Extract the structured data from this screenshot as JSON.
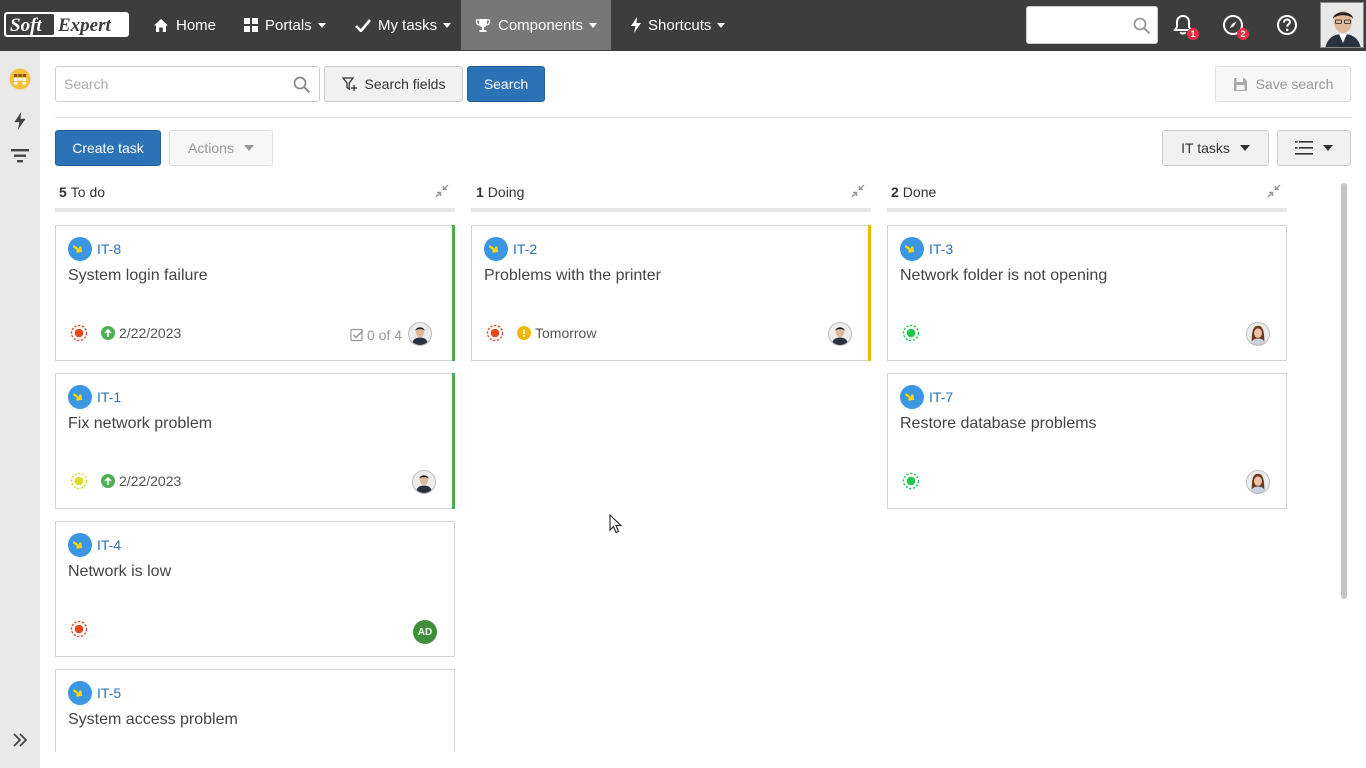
{
  "logo": {
    "part1": "Soft",
    "part2": "Expert"
  },
  "nav": {
    "home": "Home",
    "portals": "Portals",
    "my_tasks": "My tasks",
    "components": "Components",
    "shortcuts": "Shortcuts"
  },
  "top": {
    "search_placeholder": "",
    "notifications_count": "1",
    "activities_count": "2"
  },
  "toolbar": {
    "search_placeholder": "Search",
    "search_fields_label": "Search fields",
    "search_label": "Search",
    "save_search_label": "Save search",
    "create_task_label": "Create task",
    "actions_label": "Actions",
    "view_label": "IT tasks"
  },
  "columns": [
    {
      "count": "5",
      "name": "To do"
    },
    {
      "count": "1",
      "name": "Doing"
    },
    {
      "count": "2",
      "name": "Done"
    }
  ],
  "cards": [
    {
      "key": "IT-8",
      "title": "System login failure",
      "date": "2/22/2023",
      "checklist": "0 of 4"
    },
    {
      "key": "IT-1",
      "title": "Fix network problem",
      "date": "2/22/2023"
    },
    {
      "key": "IT-4",
      "title": "Network is low",
      "assignee_initials": "AD"
    },
    {
      "key": "IT-5",
      "title": "System access problem"
    },
    {
      "key": "IT-2",
      "title": "Problems with the printer",
      "date": "Tomorrow"
    },
    {
      "key": "IT-3",
      "title": "Network folder is not opening"
    },
    {
      "key": "IT-7",
      "title": "Restore database problems"
    }
  ],
  "colors": {
    "topbar": "#3d3d3d",
    "primary": "#2b73b6",
    "accent_green": "#4caf50",
    "accent_yellow": "#f2b705",
    "status_red": "#e0491b",
    "status_yellow": "#d8dc2a",
    "status_green": "#23c552"
  }
}
